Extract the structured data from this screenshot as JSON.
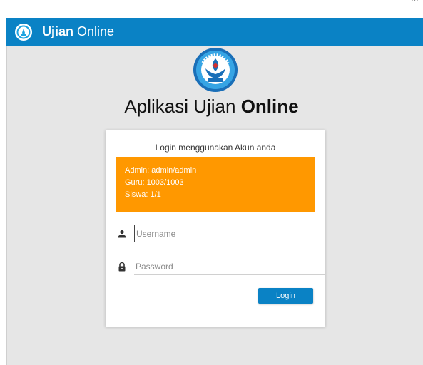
{
  "top_clip": "...",
  "navbar": {
    "brand_bold": "Ujian",
    "brand_rest": " Online"
  },
  "main": {
    "title_normal": "Aplikasi Ujian ",
    "title_bold": "Online"
  },
  "login": {
    "header": "Login menggunakan Akun anda",
    "alert": [
      "Admin: admin/admin",
      "Guru: 1003/1003",
      "Siswa: 1/1"
    ],
    "username_placeholder": "Username",
    "password_placeholder": "Password",
    "button_label": "Login"
  },
  "colors": {
    "primary": "#0a82c5",
    "alert": "#ff9800",
    "background": "#e6e6e6"
  },
  "icons": {
    "logo": "tut-wuri-handayani-emblem",
    "username": "person-icon",
    "password": "lock-icon"
  }
}
